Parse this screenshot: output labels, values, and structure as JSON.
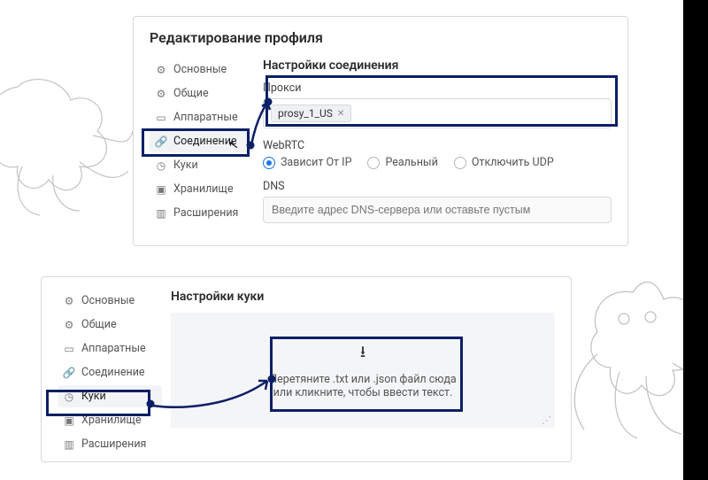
{
  "page_title": "Редактирование профиля",
  "sidebar": {
    "items": [
      {
        "label": "Основные",
        "icon": "sliders"
      },
      {
        "label": "Общие",
        "icon": "gear"
      },
      {
        "label": "Аппаратные",
        "icon": "monitor"
      },
      {
        "label": "Соединение",
        "icon": "link"
      },
      {
        "label": "Куки",
        "icon": "clock"
      },
      {
        "label": "Хранилище",
        "icon": "archive"
      },
      {
        "label": "Расширения",
        "icon": "puzzle"
      }
    ]
  },
  "top_panel": {
    "active_sidebar": "Соединение",
    "section_title": "Настройки соединения",
    "proxy_label": "Прокси",
    "proxy_tag": "prosy_1_US",
    "webrtc_label": "WebRTC",
    "webrtc_options": [
      {
        "label": "Зависит От IP",
        "checked": true
      },
      {
        "label": "Реальный",
        "checked": false
      },
      {
        "label": "Отключить UDP",
        "checked": false
      }
    ],
    "dns_label": "DNS",
    "dns_placeholder": "Введите адрес DNS-сервера или оставьте пустым"
  },
  "bottom_panel": {
    "active_sidebar": "Куки",
    "section_title": "Настройки куки",
    "drop_line1": "Перетяните .txt или .json файл сюда",
    "drop_line2": "или кликните, чтобы ввести текст."
  }
}
